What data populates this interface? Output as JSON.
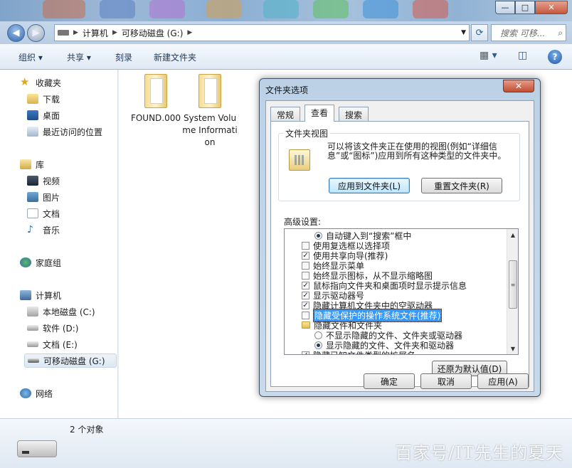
{
  "window": {
    "min_glyph": "—",
    "max_glyph": "□",
    "close_glyph": "✕"
  },
  "address": {
    "crumbs": [
      "计算机",
      "可移动磁盘 (G:)"
    ],
    "search_placeholder": "搜索 可移..."
  },
  "toolbar": {
    "organize": "组织 ▾",
    "share": "共享 ▾",
    "burn": "刻录",
    "new_folder": "新建文件夹"
  },
  "nav": {
    "favorites": "收藏夹",
    "downloads": "下载",
    "desktop": "桌面",
    "recent": "最近访问的位置",
    "libraries": "库",
    "videos": "视频",
    "pictures": "图片",
    "documents": "文档",
    "music": "音乐",
    "homegroup": "家庭组",
    "computer": "计算机",
    "drive_c": "本地磁盘 (C:)",
    "drive_d": "软件 (D:)",
    "drive_e": "文档 (E:)",
    "drive_g": "可移动磁盘 (G:)",
    "network": "网络"
  },
  "files": [
    {
      "name": "FOUND.000"
    },
    {
      "name": "System Volume Information"
    }
  ],
  "status": {
    "count": "2 个对象",
    "watermark": "百家号/IT先生的夏天"
  },
  "dialog": {
    "title": "文件夹选项",
    "close": "✕",
    "tabs": [
      "常规",
      "查看",
      "搜索"
    ],
    "group_title": "文件夹视图",
    "group_desc": "可以将该文件夹正在使用的视图(例如“详细信息”或“图标”)应用到所有这种类型的文件夹中。",
    "apply_to_folders": "应用到文件夹(L)",
    "reset_folders": "重置文件夹(R)",
    "advanced_label": "高级设置:",
    "settings": [
      {
        "kind": "radio",
        "checked": true,
        "indent": 2,
        "text": "自动键入到“搜索”框中"
      },
      {
        "kind": "check",
        "checked": false,
        "indent": 1,
        "text": "使用复选框以选择项"
      },
      {
        "kind": "check",
        "checked": true,
        "indent": 1,
        "text": "使用共享向导(推荐)"
      },
      {
        "kind": "check",
        "checked": false,
        "indent": 1,
        "text": "始终显示菜单"
      },
      {
        "kind": "check",
        "checked": false,
        "indent": 1,
        "text": "始终显示图标，从不显示缩略图"
      },
      {
        "kind": "check",
        "checked": true,
        "indent": 1,
        "text": "鼠标指向文件夹和桌面项时显示提示信息"
      },
      {
        "kind": "check",
        "checked": true,
        "indent": 1,
        "text": "显示驱动器号"
      },
      {
        "kind": "check",
        "checked": true,
        "indent": 1,
        "text": "隐藏计算机文件夹中的空驱动器"
      },
      {
        "kind": "check",
        "checked": false,
        "indent": 1,
        "text": "隐藏受保护的操作系统文件(推荐)",
        "highlight": true
      },
      {
        "kind": "folder",
        "checked": false,
        "indent": 1,
        "text": "隐藏文件和文件夹"
      },
      {
        "kind": "radio",
        "checked": false,
        "indent": 2,
        "text": "不显示隐藏的文件、文件夹或驱动器"
      },
      {
        "kind": "radio",
        "checked": true,
        "indent": 2,
        "text": "显示隐藏的文件、文件夹和驱动器"
      },
      {
        "kind": "check",
        "checked": true,
        "indent": 1,
        "text": "隐藏已知文件类型的扩展名"
      }
    ],
    "restore_defaults": "还原为默认值(D)",
    "ok": "确定",
    "cancel": "取消",
    "apply": "应用(A)"
  }
}
